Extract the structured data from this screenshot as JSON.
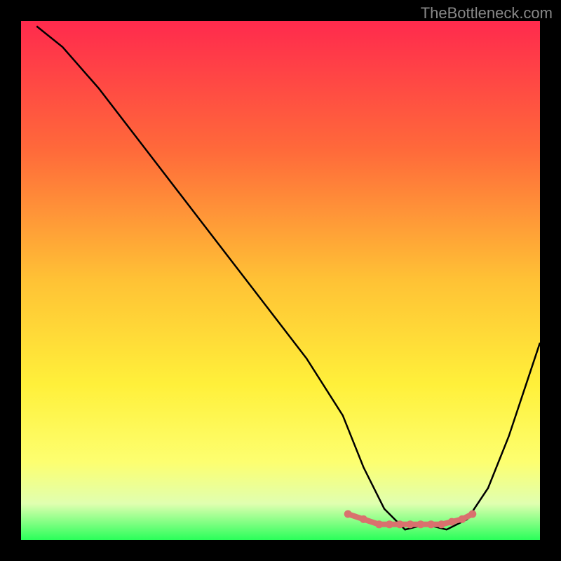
{
  "watermark": "TheBottleneck.com",
  "chart_data": {
    "type": "line",
    "title": "",
    "xlabel": "",
    "ylabel": "",
    "xlim": [
      0,
      100
    ],
    "ylim": [
      0,
      100
    ],
    "gradient_stops": [
      {
        "offset": 0,
        "color": "#ff2a4d"
      },
      {
        "offset": 25,
        "color": "#ff6a3a"
      },
      {
        "offset": 50,
        "color": "#ffc235"
      },
      {
        "offset": 70,
        "color": "#fff03a"
      },
      {
        "offset": 85,
        "color": "#fdff70"
      },
      {
        "offset": 93,
        "color": "#e0ffb0"
      },
      {
        "offset": 100,
        "color": "#2aff5a"
      }
    ],
    "series": [
      {
        "name": "bottleneck-curve",
        "x": [
          3,
          8,
          15,
          25,
          35,
          45,
          55,
          62,
          66,
          70,
          74,
          78,
          82,
          86,
          90,
          94,
          98,
          100
        ],
        "y": [
          99,
          95,
          87,
          74,
          61,
          48,
          35,
          24,
          14,
          6,
          2,
          3,
          2,
          4,
          10,
          20,
          32,
          38
        ]
      }
    ],
    "highlight_points": {
      "name": "optimal-range-markers",
      "color": "#d9716e",
      "x": [
        63,
        66,
        69,
        71,
        73,
        75,
        77,
        79,
        81,
        83,
        85,
        87
      ],
      "y": [
        5,
        4,
        3,
        3,
        3,
        3,
        3,
        3,
        3,
        3.5,
        4,
        5
      ]
    }
  }
}
